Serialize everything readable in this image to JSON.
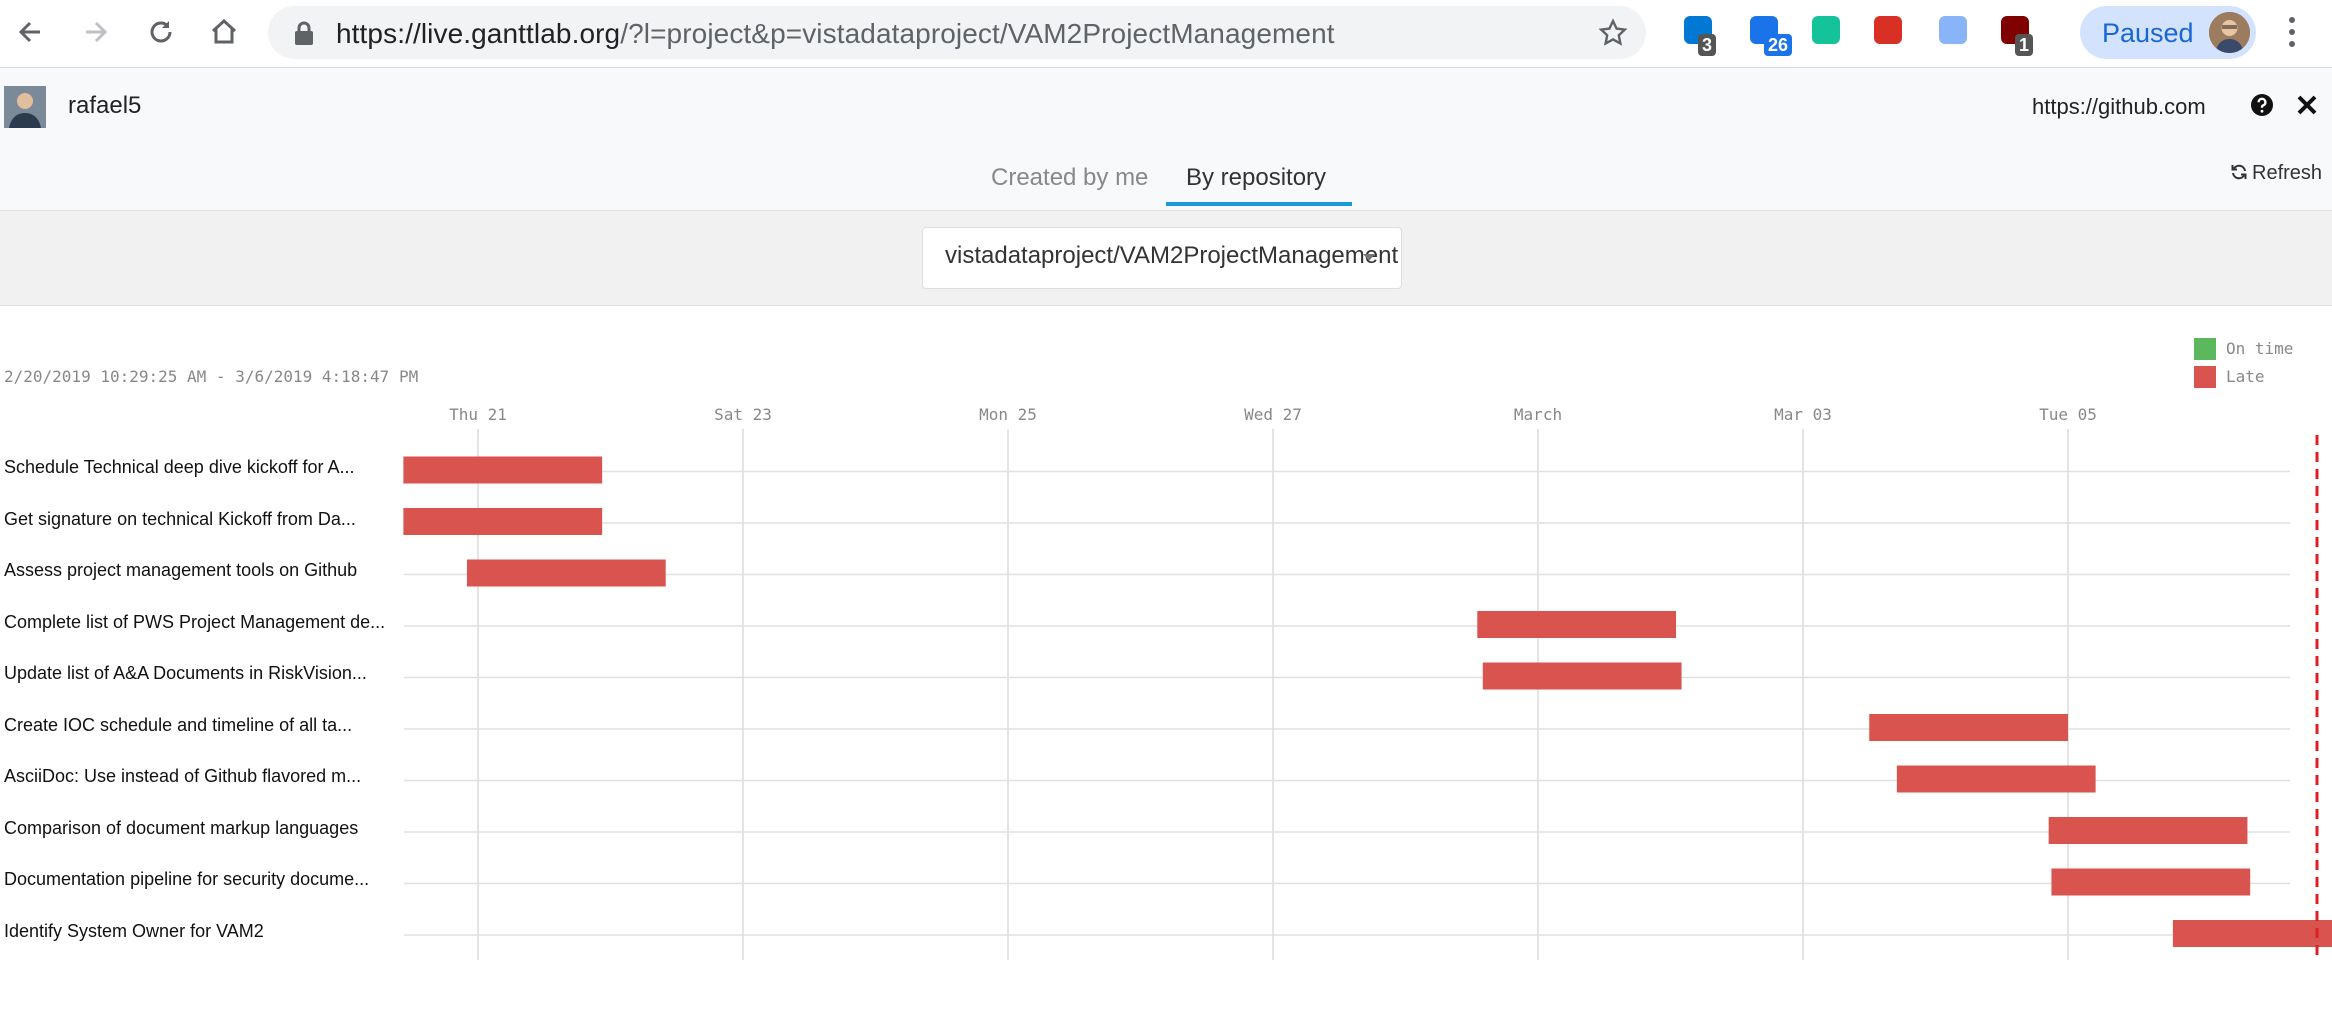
{
  "browser": {
    "url_host": "https://live.ganttlab.org",
    "url_rest": "/?l=project&p=vistadataproject/VAM2ProjectManagement",
    "extensions": [
      {
        "name": "skype-extension-icon",
        "badge": "3",
        "color": "#0078d4",
        "badge_color": "#555"
      },
      {
        "name": "clipboard-extension-icon",
        "badge": "26",
        "color": "#1a73e8",
        "badge_color": "#1a73e8"
      },
      {
        "name": "grammarly-extension-icon",
        "badge": "",
        "color": "#15c39a",
        "badge_color": ""
      },
      {
        "name": "video-extension-icon",
        "badge": "",
        "color": "#d93025",
        "badge_color": ""
      },
      {
        "name": "notebook-extension-icon",
        "badge": "",
        "color": "#8ab4f8",
        "badge_color": ""
      },
      {
        "name": "ublock-extension-icon",
        "badge": "1",
        "color": "#800000",
        "badge_color": "#555"
      }
    ],
    "profile_label": "Paused"
  },
  "header": {
    "username": "rafael5",
    "server_url": "https://github.com",
    "tabs": [
      {
        "label": "Created by me",
        "active": false
      },
      {
        "label": "By repository",
        "active": true
      }
    ],
    "refresh_label": "Refresh"
  },
  "repo_select": {
    "value": "vistadataproject/VAM2ProjectManagement"
  },
  "gantt": {
    "date_range": "2/20/2019 10:29:25 AM - 3/6/2019 4:18:47 PM",
    "legend": [
      {
        "label": "On time",
        "color": "#5cb85c"
      },
      {
        "label": "Late",
        "color": "#d9534f"
      }
    ],
    "axis_ticks": [
      "Thu 21",
      "Sat 23",
      "Mon 25",
      "Wed 27",
      "March",
      "Mar 03",
      "Tue 05"
    ],
    "tasks": [
      {
        "label": "Schedule Technical deep dive kickoff for A...",
        "start": "2019-02-20 10:29",
        "end": "2019-02-21 22:29",
        "status": "late"
      },
      {
        "label": "Get signature on technical Kickoff from Da...",
        "start": "2019-02-20 10:29",
        "end": "2019-02-21 22:29",
        "status": "late"
      },
      {
        "label": "Assess project management tools on Github",
        "start": "2019-02-20 22:00",
        "end": "2019-02-22 10:00",
        "status": "late"
      },
      {
        "label": "Complete list of PWS Project Management de...",
        "start": "2019-02-28 13:00",
        "end": "2019-03-02 01:00",
        "status": "late"
      },
      {
        "label": "Update list of A&A Documents in RiskVision...",
        "start": "2019-02-28 14:00",
        "end": "2019-03-02 02:00",
        "status": "late"
      },
      {
        "label": "Create IOC schedule and timeline of all ta...",
        "start": "2019-03-03 12:00",
        "end": "2019-03-05 00:00",
        "status": "late"
      },
      {
        "label": "AsciiDoc: Use instead of Github flavored m...",
        "start": "2019-03-03 17:00",
        "end": "2019-03-05 05:00",
        "status": "late"
      },
      {
        "label": "Comparison of document markup languages",
        "start": "2019-03-04 20:30",
        "end": "2019-03-06 08:30",
        "status": "late"
      },
      {
        "label": "Documentation pipeline for security docume...",
        "start": "2019-03-04 21:00",
        "end": "2019-03-06 09:00",
        "status": "late"
      },
      {
        "label": "Identify System Owner for VAM2",
        "start": "2019-03-05 19:00",
        "end": "2019-03-07 07:00",
        "status": "late"
      }
    ]
  }
}
